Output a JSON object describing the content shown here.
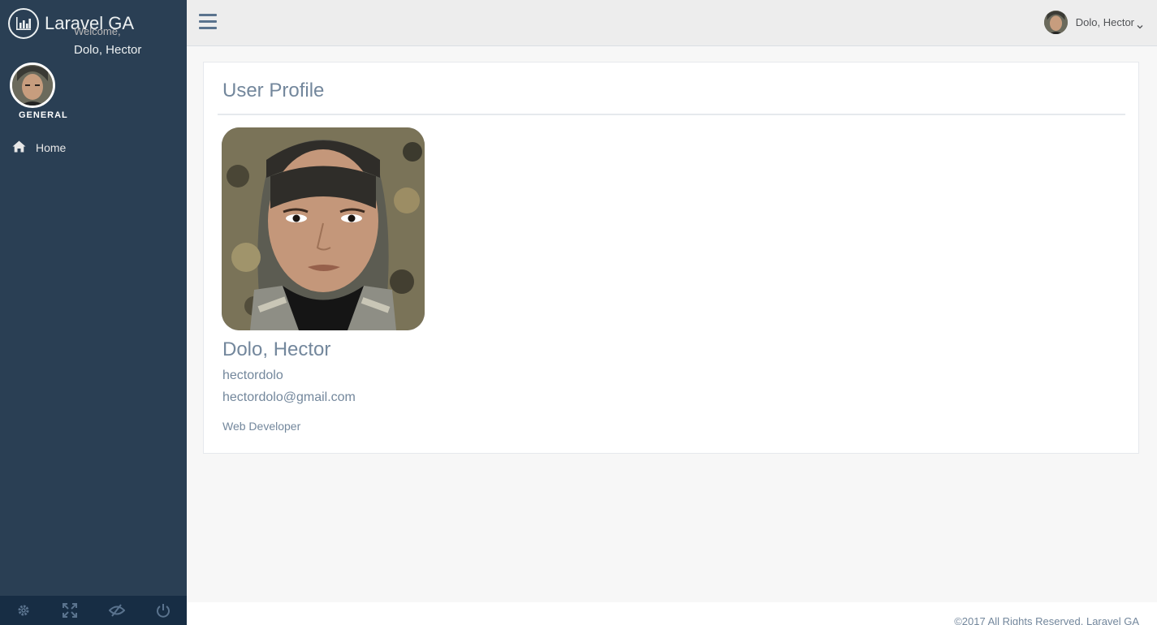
{
  "app": {
    "title": "Laravel GA"
  },
  "sidebar": {
    "welcome_text": "Welcome,",
    "user_name": "Dolo, Hector",
    "section_title": "GENERAL",
    "items": [
      {
        "label": "Home",
        "icon": "home-icon"
      }
    ],
    "footer_icons": [
      "settings-icon",
      "fullscreen-icon",
      "lock-icon",
      "logout-icon"
    ]
  },
  "topnav": {
    "user_name": "Dolo, Hector"
  },
  "profile": {
    "title": "User Profile",
    "name": "Dolo, Hector",
    "username": "hectordolo",
    "email": "hectordolo@gmail.com",
    "role": "Web Developer"
  },
  "footer": {
    "copyright": "©2017 All Rights Reserved. Laravel GA"
  },
  "colors": {
    "sidebar_bg": "#2A3F54",
    "sidebar_footer": "#172D44",
    "topnav_bg": "#EDEDED",
    "text": "#73879C"
  }
}
